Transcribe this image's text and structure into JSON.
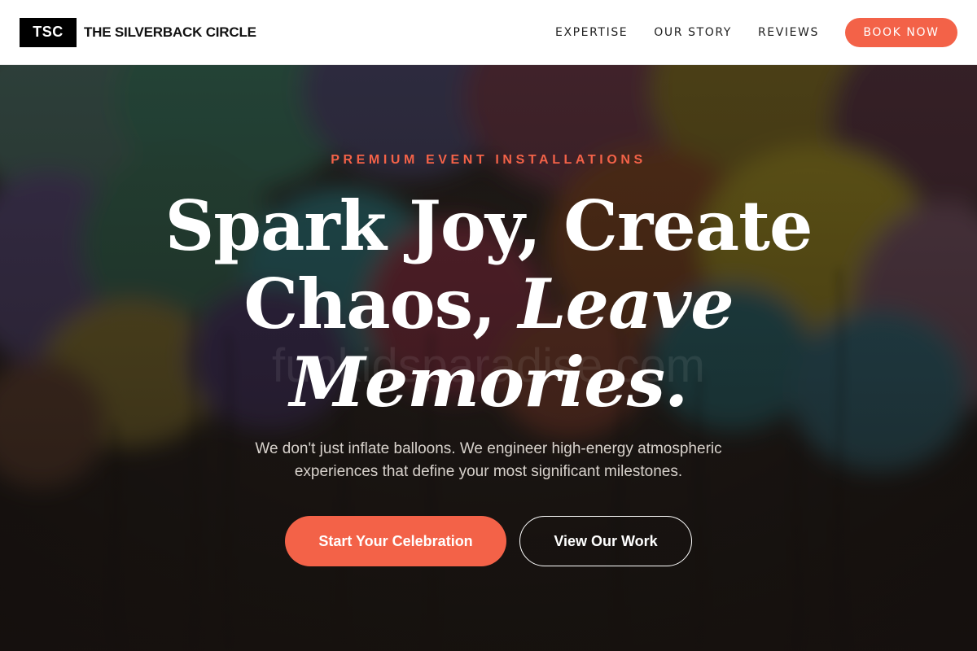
{
  "brand": {
    "mark": "TSC",
    "name": "THE SILVERBACK CIRCLE"
  },
  "nav": {
    "links": [
      "EXPERTISE",
      "OUR STORY",
      "REVIEWS"
    ],
    "cta_label": "BOOK NOW"
  },
  "hero": {
    "eyebrow": "PREMIUM EVENT INSTALLATIONS",
    "headline_line1": "Spark Joy, Create",
    "headline_line2_regular": "Chaos, ",
    "headline_line2_italic": "Leave",
    "headline_line3_italic": "Memories.",
    "subtext": "We don't just inflate balloons. We engineer high-energy atmospheric experiences that define your most significant milestones.",
    "primary_button": "Start Your Celebration",
    "secondary_button": "View Our Work",
    "watermark": "funkidsparadise.com"
  },
  "colors": {
    "accent": "#f36248",
    "header_bg": "#ffffff",
    "brand_mark_bg": "#000000",
    "text_light": "#ffffff"
  },
  "background": {
    "description_icon": "balloons-photo-background"
  }
}
